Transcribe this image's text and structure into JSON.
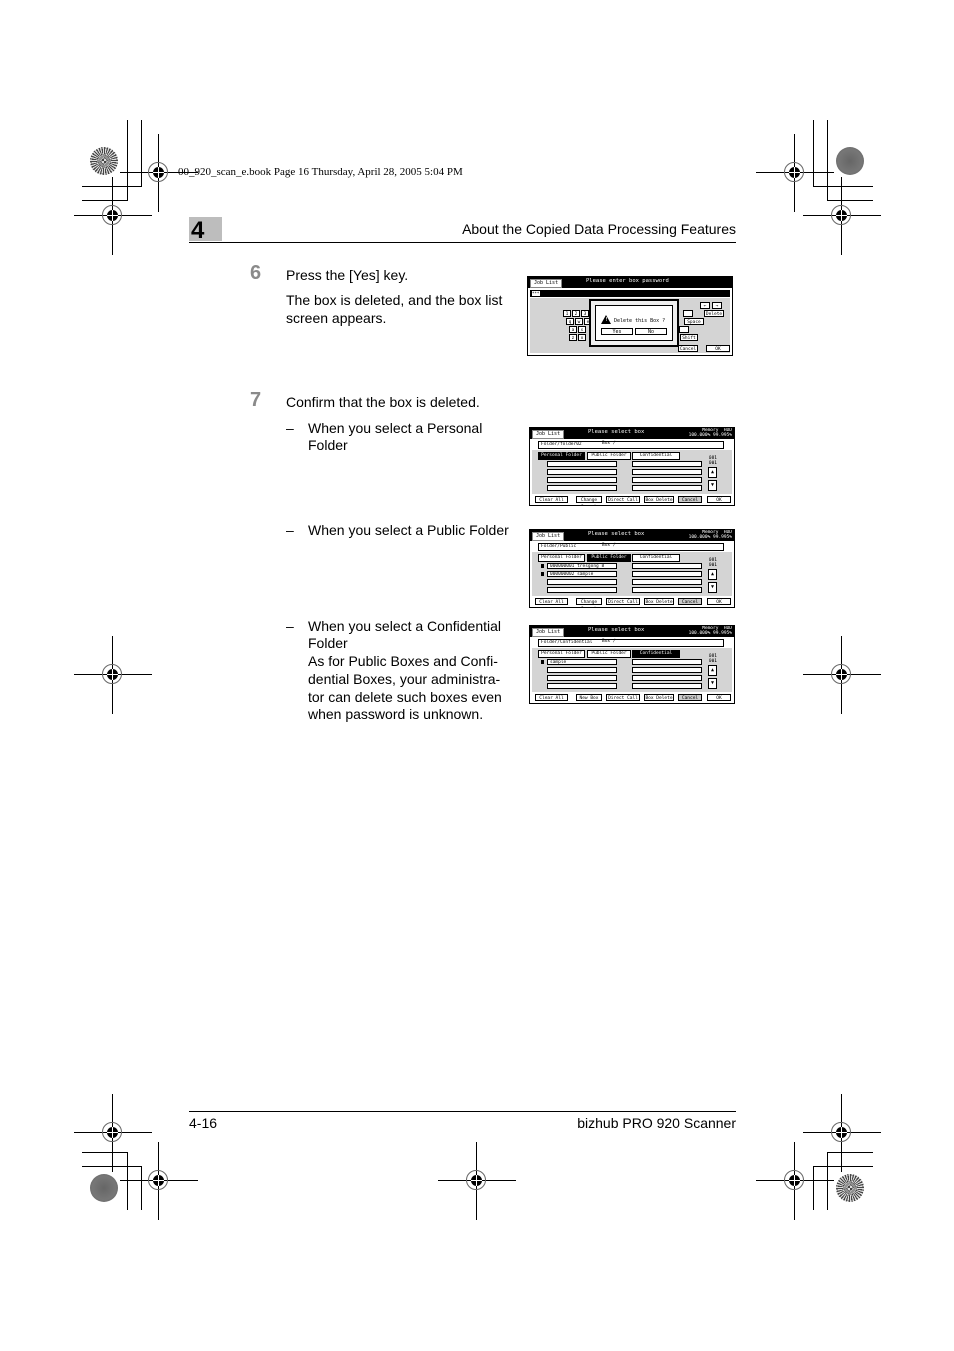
{
  "print_info": "00_920_scan_e.book  Page 16  Thursday, April 28, 2005  5:04 PM",
  "header": {
    "chapter_number": "4",
    "title": "About the Copied Data Processing Features"
  },
  "steps": [
    {
      "number": "6",
      "instruction": "Press the [Yes] key.",
      "result_lines": [
        "The box is deleted, and the box list",
        "screen appears."
      ],
      "screenshot": {
        "title": "Please enter box password",
        "job_list": "Job List",
        "password_value": "***",
        "keys_row1": [
          "1",
          "2",
          "3"
        ],
        "keys_row2": [
          "q",
          "w",
          "e"
        ],
        "keys_row3": [
          "a",
          "s"
        ],
        "keys_row4": [
          "z",
          "x"
        ],
        "right_keys": [
          "←",
          "→",
          "Delete",
          "Space",
          "Shift"
        ],
        "dialog_message": "Delete this Box ?",
        "yes_label": "Yes",
        "no_label": "No",
        "cancel_label": "Cancel",
        "ok_label": "OK"
      }
    },
    {
      "number": "7",
      "instruction": "Confirm that the box is deleted.",
      "cases": [
        {
          "dash": "–",
          "lines": [
            "When you select a Personal",
            "Folder"
          ],
          "screenshot": {
            "title": "Please select box",
            "job_list": "Job List",
            "memory_label": "Memory",
            "hdd_label": "HDD",
            "memory_value": "100.000%",
            "hdd_value": "99.995%",
            "path": "Folder/folder02",
            "box_label": "Box  /",
            "tabs": [
              "Personal Folder",
              "Public Folder",
              "Confidential"
            ],
            "selected_tab": 0,
            "page_current": "001",
            "page_total": "001",
            "rows_left": [
              "",
              "",
              "",
              ""
            ],
            "rows_right": [
              "",
              "",
              "",
              ""
            ],
            "buttons": [
              "Clear All",
              "Change Search",
              "Direct Call",
              "Box Delete",
              "Cancel",
              "OK"
            ]
          }
        },
        {
          "dash": "–",
          "lines": [
            "When you select a Public Folder"
          ],
          "screenshot": {
            "title": "Please select box",
            "job_list": "Job List",
            "memory_label": "Memory",
            "hdd_label": "HDD",
            "memory_value": "100.000%",
            "hdd_value": "99.995%",
            "path": "Folder/Public",
            "box_label": "Box  /",
            "tabs": [
              "Personal Folder",
              "Public Folder",
              "Confidential"
            ],
            "selected_tab": 1,
            "page_current": "001",
            "page_total": "001",
            "rows_left": [
              "000000001 tresgong 8",
              "000000002 sample",
              "",
              ""
            ],
            "rows_right": [
              "",
              "",
              "",
              ""
            ],
            "buttons": [
              "Clear All",
              "Change Search",
              "Direct Call",
              "Box Delete",
              "Cancel",
              "OK"
            ]
          }
        },
        {
          "dash": "–",
          "lines": [
            "When you select a Confidential",
            "Folder",
            "As for Public Boxes and Confi-",
            "dential Boxes, your administra-",
            "tor can delete such boxes even",
            "when password is unknown."
          ],
          "screenshot": {
            "title": "Please select box",
            "job_list": "Job List",
            "memory_label": "Memory",
            "hdd_label": "HDD",
            "memory_value": "100.000%",
            "hdd_value": "99.995%",
            "path": "Folder/Confidential",
            "box_label": "Box  /",
            "tabs": [
              "Personal Folder",
              "Public Folder",
              "Confidential"
            ],
            "selected_tab": 2,
            "page_current": "001",
            "page_total": "001",
            "rows_left": [
              "sample",
              "",
              "",
              ""
            ],
            "rows_right": [
              "",
              "",
              "",
              ""
            ],
            "buttons": [
              "Clear All",
              "New Box",
              "Direct Call",
              "Box Delete",
              "Cancel",
              "OK"
            ]
          }
        }
      ]
    }
  ],
  "footer": {
    "page_number": "4-16",
    "product": "bizhub PRO 920 Scanner"
  }
}
